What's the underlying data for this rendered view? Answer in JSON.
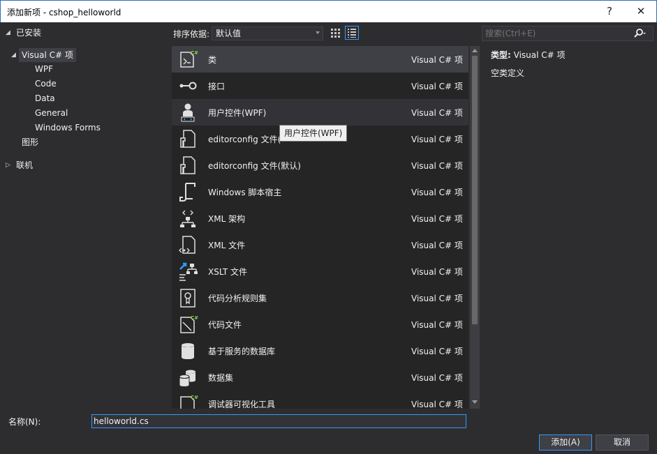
{
  "window": {
    "title": "添加新项 - cshop_helloworld",
    "help": "?",
    "close": "✕"
  },
  "tree": {
    "installed": "已安装",
    "visual_cs": "Visual C# 项",
    "children": [
      "WPF",
      "Code",
      "Data",
      "General",
      "Windows Forms"
    ],
    "graphics": "图形",
    "online": "联机"
  },
  "toolbar": {
    "sort_label": "排序依据:",
    "sort_value": "默认值"
  },
  "search": {
    "placeholder": "搜索(Ctrl+E)"
  },
  "items": [
    {
      "name": "类",
      "lang": "Visual C# 项",
      "icon": "class-icon"
    },
    {
      "name": "接口",
      "lang": "Visual C# 项",
      "icon": "interface-icon"
    },
    {
      "name": "用户控件(WPF)",
      "lang": "Visual C# 项",
      "icon": "user-control-icon"
    },
    {
      "name": "editorconfig 文件(",
      "lang": "Visual C# 项",
      "icon": "editorconfig-icon"
    },
    {
      "name": "editorconfig 文件(默认)",
      "lang": "Visual C# 项",
      "icon": "editorconfig-icon"
    },
    {
      "name": "Windows 脚本宿主",
      "lang": "Visual C# 项",
      "icon": "script-icon"
    },
    {
      "name": "XML 架构",
      "lang": "Visual C# 项",
      "icon": "xml-schema-icon"
    },
    {
      "name": "XML 文件",
      "lang": "Visual C# 项",
      "icon": "xml-file-icon"
    },
    {
      "name": "XSLT 文件",
      "lang": "Visual C# 项",
      "icon": "xslt-icon"
    },
    {
      "name": "代码分析规则集",
      "lang": "Visual C# 项",
      "icon": "ruleset-icon"
    },
    {
      "name": "代码文件",
      "lang": "Visual C# 项",
      "icon": "code-file-icon"
    },
    {
      "name": "基于服务的数据库",
      "lang": "Visual C# 项",
      "icon": "database-icon"
    },
    {
      "name": "数据集",
      "lang": "Visual C# 项",
      "icon": "dataset-icon"
    },
    {
      "name": "调试器可视化工具",
      "lang": "Visual C# 项",
      "icon": "visualizer-icon"
    }
  ],
  "tooltip": "用户控件(WPF)",
  "details": {
    "type_label": "类型:",
    "type_value": "Visual C# 项",
    "description": "空类定义"
  },
  "bottom": {
    "name_label": "名称(N):",
    "name_value": "helloworld.cs",
    "add_label": "添加(A)",
    "cancel_label": "取消"
  },
  "colors": {
    "background": "#2d2d30",
    "list_bg": "#252526",
    "selected": "#3f3f46",
    "accent": "#3399ff"
  }
}
